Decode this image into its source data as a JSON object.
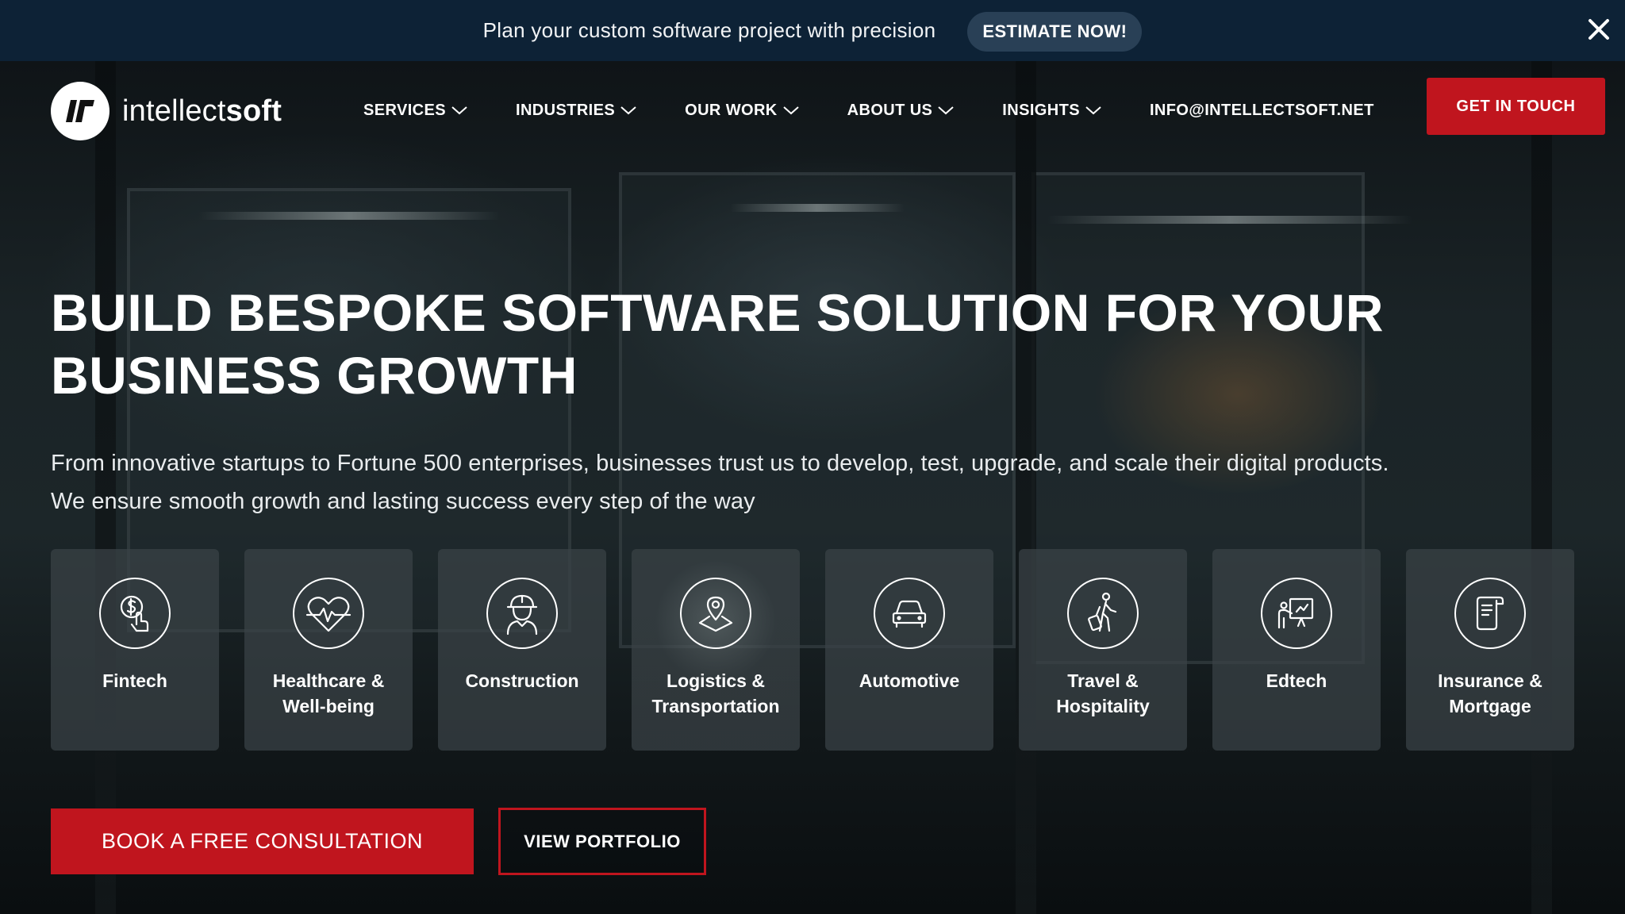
{
  "announcement": {
    "text": "Plan your custom software project with precision",
    "cta_label": "ESTIMATE NOW!",
    "close_icon": "close-icon"
  },
  "header": {
    "logo_mark": "IS",
    "logo_text_light": "intellect",
    "logo_text_bold": "soft",
    "nav": [
      {
        "label": "SERVICES",
        "icon": "chevron-down-icon"
      },
      {
        "label": "INDUSTRIES",
        "icon": "chevron-down-icon"
      },
      {
        "label": "OUR WORK",
        "icon": "chevron-down-icon"
      },
      {
        "label": "ABOUT US",
        "icon": "chevron-down-icon"
      },
      {
        "label": "INSIGHTS",
        "icon": "chevron-down-icon"
      }
    ],
    "email": "INFO@INTELLECTSOFT.NET",
    "cta_label": "GET IN TOUCH"
  },
  "hero": {
    "headline_line1": "BUILD BESPOKE SOFTWARE SOLUTION FOR YOUR",
    "headline_line2": "BUSINESS GROWTH",
    "subline_line1": "From innovative startups to Fortune 500 enterprises, businesses trust us to develop, test, upgrade, and scale their digital products.",
    "subline_line2": "We ensure smooth growth and lasting success every step of the way"
  },
  "industries": [
    {
      "line1": "Fintech",
      "line2": "",
      "icon": "fintech-icon"
    },
    {
      "line1": "Healthcare &",
      "line2": "Well-being",
      "icon": "healthcare-icon"
    },
    {
      "line1": "Construction",
      "line2": "",
      "icon": "construction-icon"
    },
    {
      "line1": "Logistics &",
      "line2": "Transportation",
      "icon": "logistics-icon"
    },
    {
      "line1": "Automotive",
      "line2": "",
      "icon": "automotive-icon"
    },
    {
      "line1": "Travel &",
      "line2": "Hospitality",
      "icon": "travel-icon"
    },
    {
      "line1": "Edtech",
      "line2": "",
      "icon": "edtech-icon"
    },
    {
      "line1": "Insurance &",
      "line2": "Mortgage",
      "icon": "insurance-icon"
    }
  ],
  "cta": {
    "primary_label": "BOOK A FREE CONSULTATION",
    "secondary_label": "VIEW PORTFOLIO"
  },
  "colors": {
    "accent": "#c0151e",
    "top_bar": "#0d2236",
    "estimate_button": "#294056",
    "card_bg": "#3a4246"
  }
}
